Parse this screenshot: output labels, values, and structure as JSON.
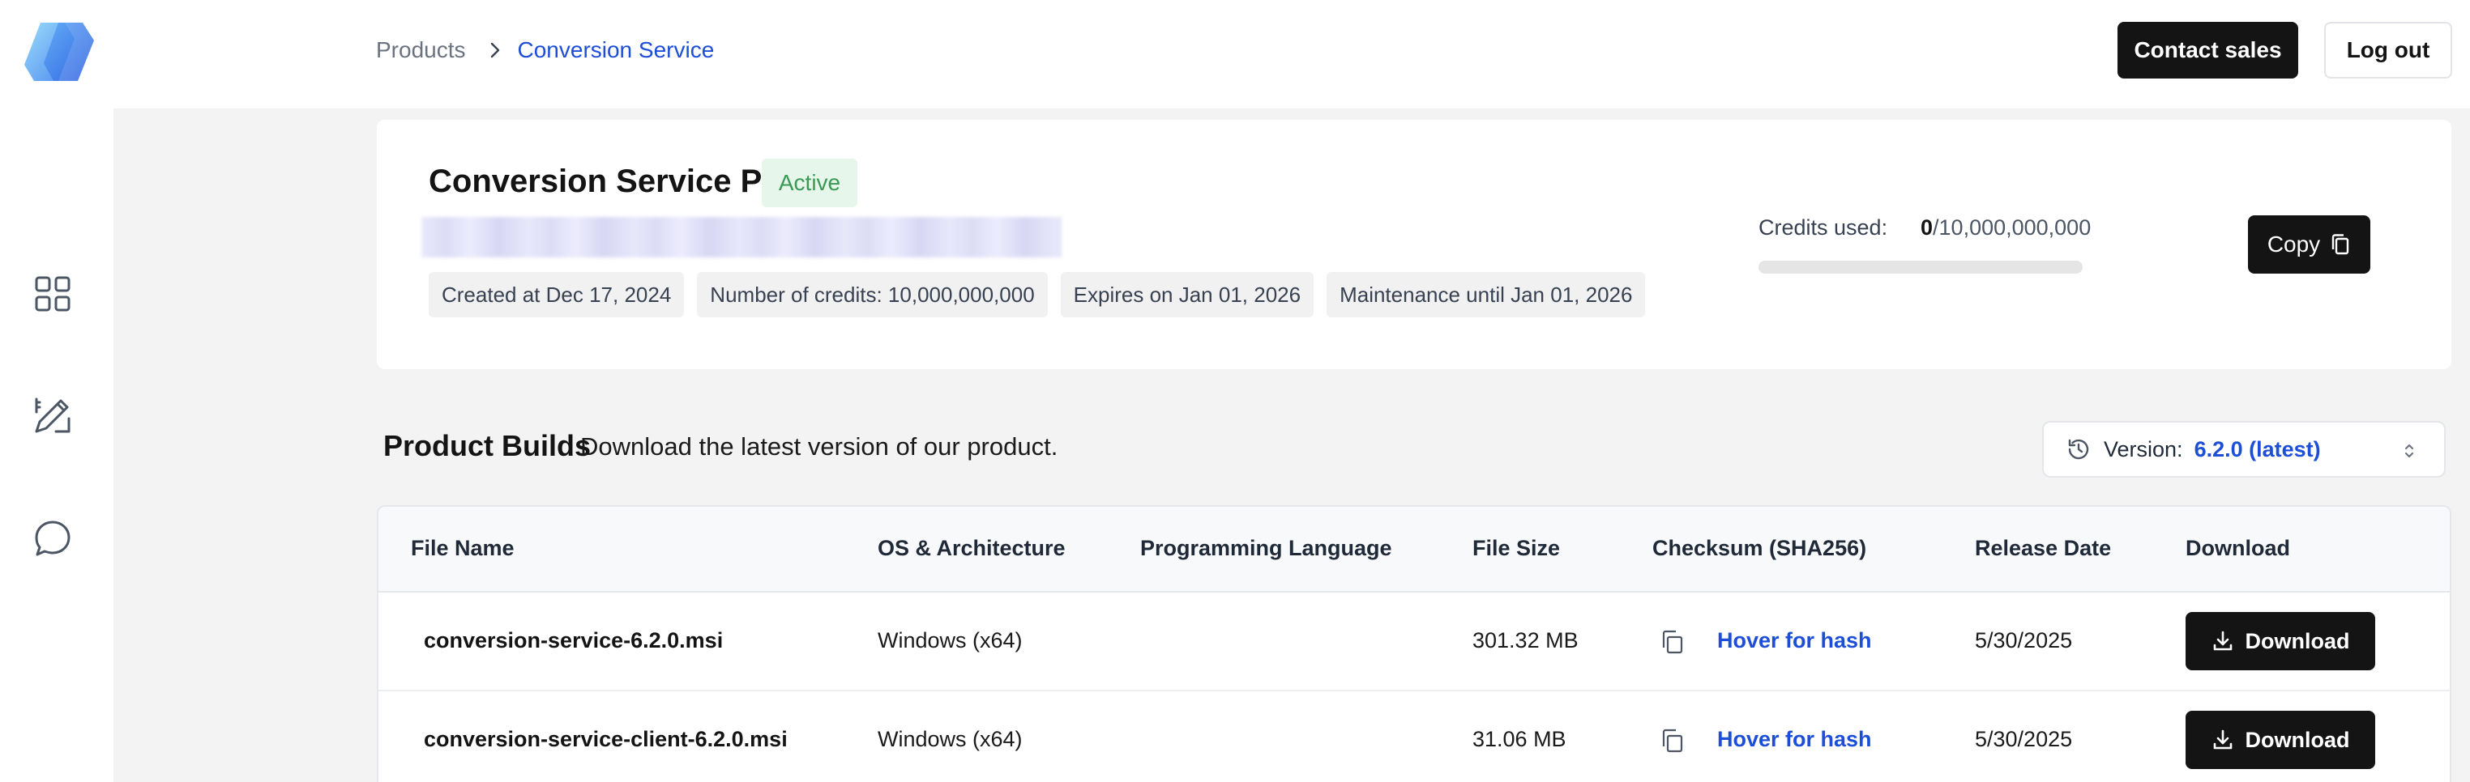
{
  "header": {
    "breadcrumb": [
      "Products",
      "Conversion Service"
    ],
    "contact_label": "Contact sales",
    "logout_label": "Log out"
  },
  "sidebar": {
    "items": [
      {
        "icon": "grid-icon"
      },
      {
        "icon": "pen-ruler-icon"
      },
      {
        "icon": "chat-bubble-icon"
      }
    ]
  },
  "product": {
    "title": "Conversion Service Pro",
    "status": "Active",
    "tags": [
      "Created at Dec 17, 2024",
      "Number of credits: 10,000,000,000",
      "Expires on Jan 01, 2026",
      "Maintenance until Jan 01, 2026"
    ],
    "credits_label": "Credits used:",
    "credits_used": "0",
    "credits_total": "/10,000,000,000",
    "credits_fraction": 0,
    "copy_label": "Copy"
  },
  "builds": {
    "title": "Product Builds",
    "subtitle": "Download the latest version of our product.",
    "version_label": "Version:",
    "version_value": "6.2.0 (latest)",
    "columns": [
      "File Name",
      "OS & Architecture",
      "Programming Language",
      "File Size",
      "Checksum (SHA256)",
      "Release Date",
      "Download"
    ],
    "rows": [
      {
        "file": "conversion-service-6.2.0.msi",
        "os": "Windows (x64)",
        "lang": "",
        "size": "301.32 MB",
        "checksum": "Hover for hash",
        "date": "5/30/2025",
        "download": "Download"
      },
      {
        "file": "conversion-service-client-6.2.0.msi",
        "os": "Windows (x64)",
        "lang": "",
        "size": "31.06 MB",
        "checksum": "Hover for hash",
        "date": "5/30/2025",
        "download": "Download"
      }
    ]
  },
  "colors": {
    "accent": "#1d4ed8",
    "active_bg": "#e6f6ea",
    "active_text": "#3a9a55",
    "dark": "#141414"
  }
}
